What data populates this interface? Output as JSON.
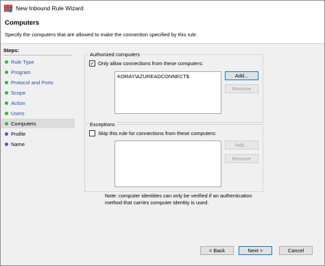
{
  "window": {
    "title": "New Inbound Rule Wizard",
    "icon": "firewall-rule-icon"
  },
  "header": {
    "title": "Computers",
    "description": "Specify the computers that are allowed to make the connection specified by this rule."
  },
  "sidebar": {
    "steps_label": "Steps:",
    "items": [
      {
        "label": "Rule Type",
        "state": "done"
      },
      {
        "label": "Program",
        "state": "done"
      },
      {
        "label": "Protocol and Ports",
        "state": "done"
      },
      {
        "label": "Scope",
        "state": "done"
      },
      {
        "label": "Action",
        "state": "done"
      },
      {
        "label": "Users",
        "state": "done"
      },
      {
        "label": "Computers",
        "state": "current"
      },
      {
        "label": "Profile",
        "state": "pending"
      },
      {
        "label": "Name",
        "state": "pending"
      }
    ]
  },
  "authorized": {
    "group_label": "Authorized computers",
    "checkbox_label": "Only allow connections from these computers:",
    "checked": true,
    "list": [
      "KORAY\\AZUREADCONNECT$"
    ],
    "add_label": "Add...",
    "remove_label": "Remove"
  },
  "exceptions": {
    "group_label": "Exceptions",
    "checkbox_label": "Skip this rule for connections from these computers:",
    "checked": false,
    "list": [],
    "add_label": "Add...",
    "remove_label": "Remove"
  },
  "note": {
    "line1": "Note: computer identities can only be verified if an authentication",
    "line2": "method that carries computer identity is used."
  },
  "footer": {
    "back_label": "< Back",
    "next_label": "Next >",
    "cancel_label": "Cancel"
  },
  "colors": {
    "done": "#2eb82e",
    "pending": "#5b4fc8",
    "link": "#1f4fb5",
    "focus": "#0078d7"
  }
}
